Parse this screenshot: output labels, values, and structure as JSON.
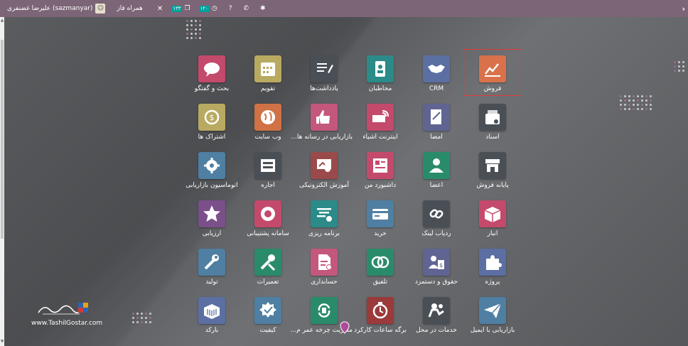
{
  "topbar": {
    "user_name": "علیرضا غضنفری (sazmanyar)",
    "company": "همراه فاز",
    "badge_1": "۱۲۰",
    "badge_2": "۱۳۳",
    "avatar_icon": "user-avatar-icon"
  },
  "logo": {
    "script_text": "تسهیل گستر",
    "web_text": "www.TashilGostar.com"
  },
  "apps": [
    {
      "label": "فروش",
      "icon": "sales-chart-icon",
      "color": "#d9724a"
    },
    {
      "label": "CRM",
      "icon": "handshake-icon",
      "color": "#5b6fa3"
    },
    {
      "label": "مخاطبان",
      "icon": "contacts-icon",
      "color": "#2a8b89"
    },
    {
      "label": "یادداشت‌ها",
      "icon": "notes-icon",
      "color": "#4a4f56"
    },
    {
      "label": "تقویم",
      "icon": "calendar-icon",
      "color": "#b9aa62"
    },
    {
      "label": "بحث و گفتگو",
      "icon": "chat-icon",
      "color": "#c44a6b"
    },
    {
      "label": "اسناد",
      "icon": "documents-icon",
      "color": "#4a4f56"
    },
    {
      "label": "امضا",
      "icon": "sign-icon",
      "color": "#5f6492"
    },
    {
      "label": "اینترنت اشیاء",
      "icon": "iot-icon",
      "color": "#c44a6b"
    },
    {
      "label": "بازاریابی در رسانه ها...",
      "icon": "social-marketing-icon",
      "color": "#c4577c"
    },
    {
      "label": "وب سایت",
      "icon": "website-globe-icon",
      "color": "#d07245"
    },
    {
      "label": "اشتراک ها",
      "icon": "subscriptions-icon",
      "color": "#b9aa62"
    },
    {
      "label": "پایانه فروش",
      "icon": "pos-store-icon",
      "color": "#4a4f56"
    },
    {
      "label": "اعضا",
      "icon": "members-icon",
      "color": "#2a8b6a"
    },
    {
      "label": "داشبورد من",
      "icon": "dashboard-icon",
      "color": "#c44a6b"
    },
    {
      "label": "آموزش الکترونیکی",
      "icon": "elearning-icon",
      "color": "#9a4a4a"
    },
    {
      "label": "اجاره",
      "icon": "rental-icon",
      "color": "#4a4f56"
    },
    {
      "label": "اتوماسیون بازاریابی",
      "icon": "marketing-automation-icon",
      "color": "#4f7fa3"
    },
    {
      "label": "انبار",
      "icon": "inventory-box-icon",
      "color": "#c44a6b"
    },
    {
      "label": "ردیاب لینک",
      "icon": "link-tracker-icon",
      "color": "#4a4f56"
    },
    {
      "label": "خرید",
      "icon": "purchase-card-icon",
      "color": "#4f7fa3"
    },
    {
      "label": "برنامه ریزی",
      "icon": "planning-icon",
      "color": "#2a8b89"
    },
    {
      "label": "سامانه پشتیبانی",
      "icon": "helpdesk-lifebuoy-icon",
      "color": "#c44a6b"
    },
    {
      "label": "ارزیابی",
      "icon": "appraisal-star-icon",
      "color": "#7a4f8a"
    },
    {
      "label": "پروژه",
      "icon": "project-puzzle-icon",
      "color": "#5b6fa3"
    },
    {
      "label": "حقوق و دستمزد",
      "icon": "payroll-icon",
      "color": "#5f6492"
    },
    {
      "label": "تلفیق",
      "icon": "consolidation-icon",
      "color": "#2a8b6a"
    },
    {
      "label": "حسابداری",
      "icon": "accounting-icon",
      "color": "#c4577c"
    },
    {
      "label": "تعمیرات",
      "icon": "maintenance-tools-icon",
      "color": "#2a8b6a"
    },
    {
      "label": "تولید",
      "icon": "manufacturing-wrench-icon",
      "color": "#4f7fa3"
    },
    {
      "label": "بازاریابی با ایمیل",
      "icon": "email-marketing-icon",
      "color": "#4f7fa3"
    },
    {
      "label": "خدمات در محل",
      "icon": "field-service-icon",
      "color": "#4a4f56"
    },
    {
      "label": "برگه ساعات کارکرد",
      "icon": "timesheet-icon",
      "color": "#9a3a3a"
    },
    {
      "label": "مدیریت چرخه عمر م...",
      "icon": "plm-cycle-icon",
      "color": "#2a8b6a"
    },
    {
      "label": "کیفیت",
      "icon": "quality-icon",
      "color": "#4f7fa3"
    },
    {
      "label": "بارکد",
      "icon": "barcode-box-icon",
      "color": "#5b6fa3"
    }
  ]
}
